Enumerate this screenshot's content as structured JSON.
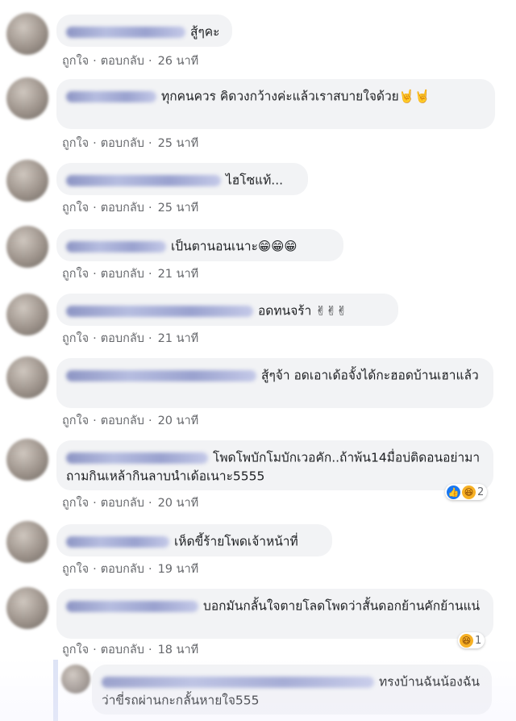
{
  "actions": {
    "like": "ถูกใจ",
    "reply": "ตอบกลับ",
    "separator": "·"
  },
  "comments": [
    {
      "text": "สู้ๆคะ",
      "time": "26 นาที"
    },
    {
      "text": "ทุกคนควร คิดวงกว้างค่ะแล้วเราสบายใจด้วย🤘🤘",
      "time": "25 นาที"
    },
    {
      "text": "ไฮโซแท้...",
      "time": "25 นาที"
    },
    {
      "text": "เป็นตานอนเนาะ😁😁😁",
      "time": "21 นาที"
    },
    {
      "text": "อดทนจร้า ✌✌✌",
      "time": "21 นาที"
    },
    {
      "text": "สู้ๆจ้า อดเอาเด้อจั้งได้กะฮอดบ้านเฮาแล้ว",
      "time": "20 นาที"
    },
    {
      "text": "โพดโพบักโมบักเวอคัก..ถ้าพ้น14มื่อบ่ติดอนอย่ามาถามกินเหล้ากินลาบนำเด้อเนาะ5555",
      "time": "20 นาที",
      "reaction_count": "2"
    },
    {
      "text": "เห็ดขี้ร้ายโพดเจ้าหน้าที่",
      "time": "19 นาที"
    },
    {
      "text": "บอกมันกลั้นใจตายโลดโพดว่าสั้นดอกย้านคักย้านแน่",
      "time": "18 นาที",
      "reaction_count": "1"
    },
    {
      "text": "ทรงบ้านฉันน้องฉันว่าขี่รถผ่านกะกลั้นหายใจ555"
    }
  ]
}
